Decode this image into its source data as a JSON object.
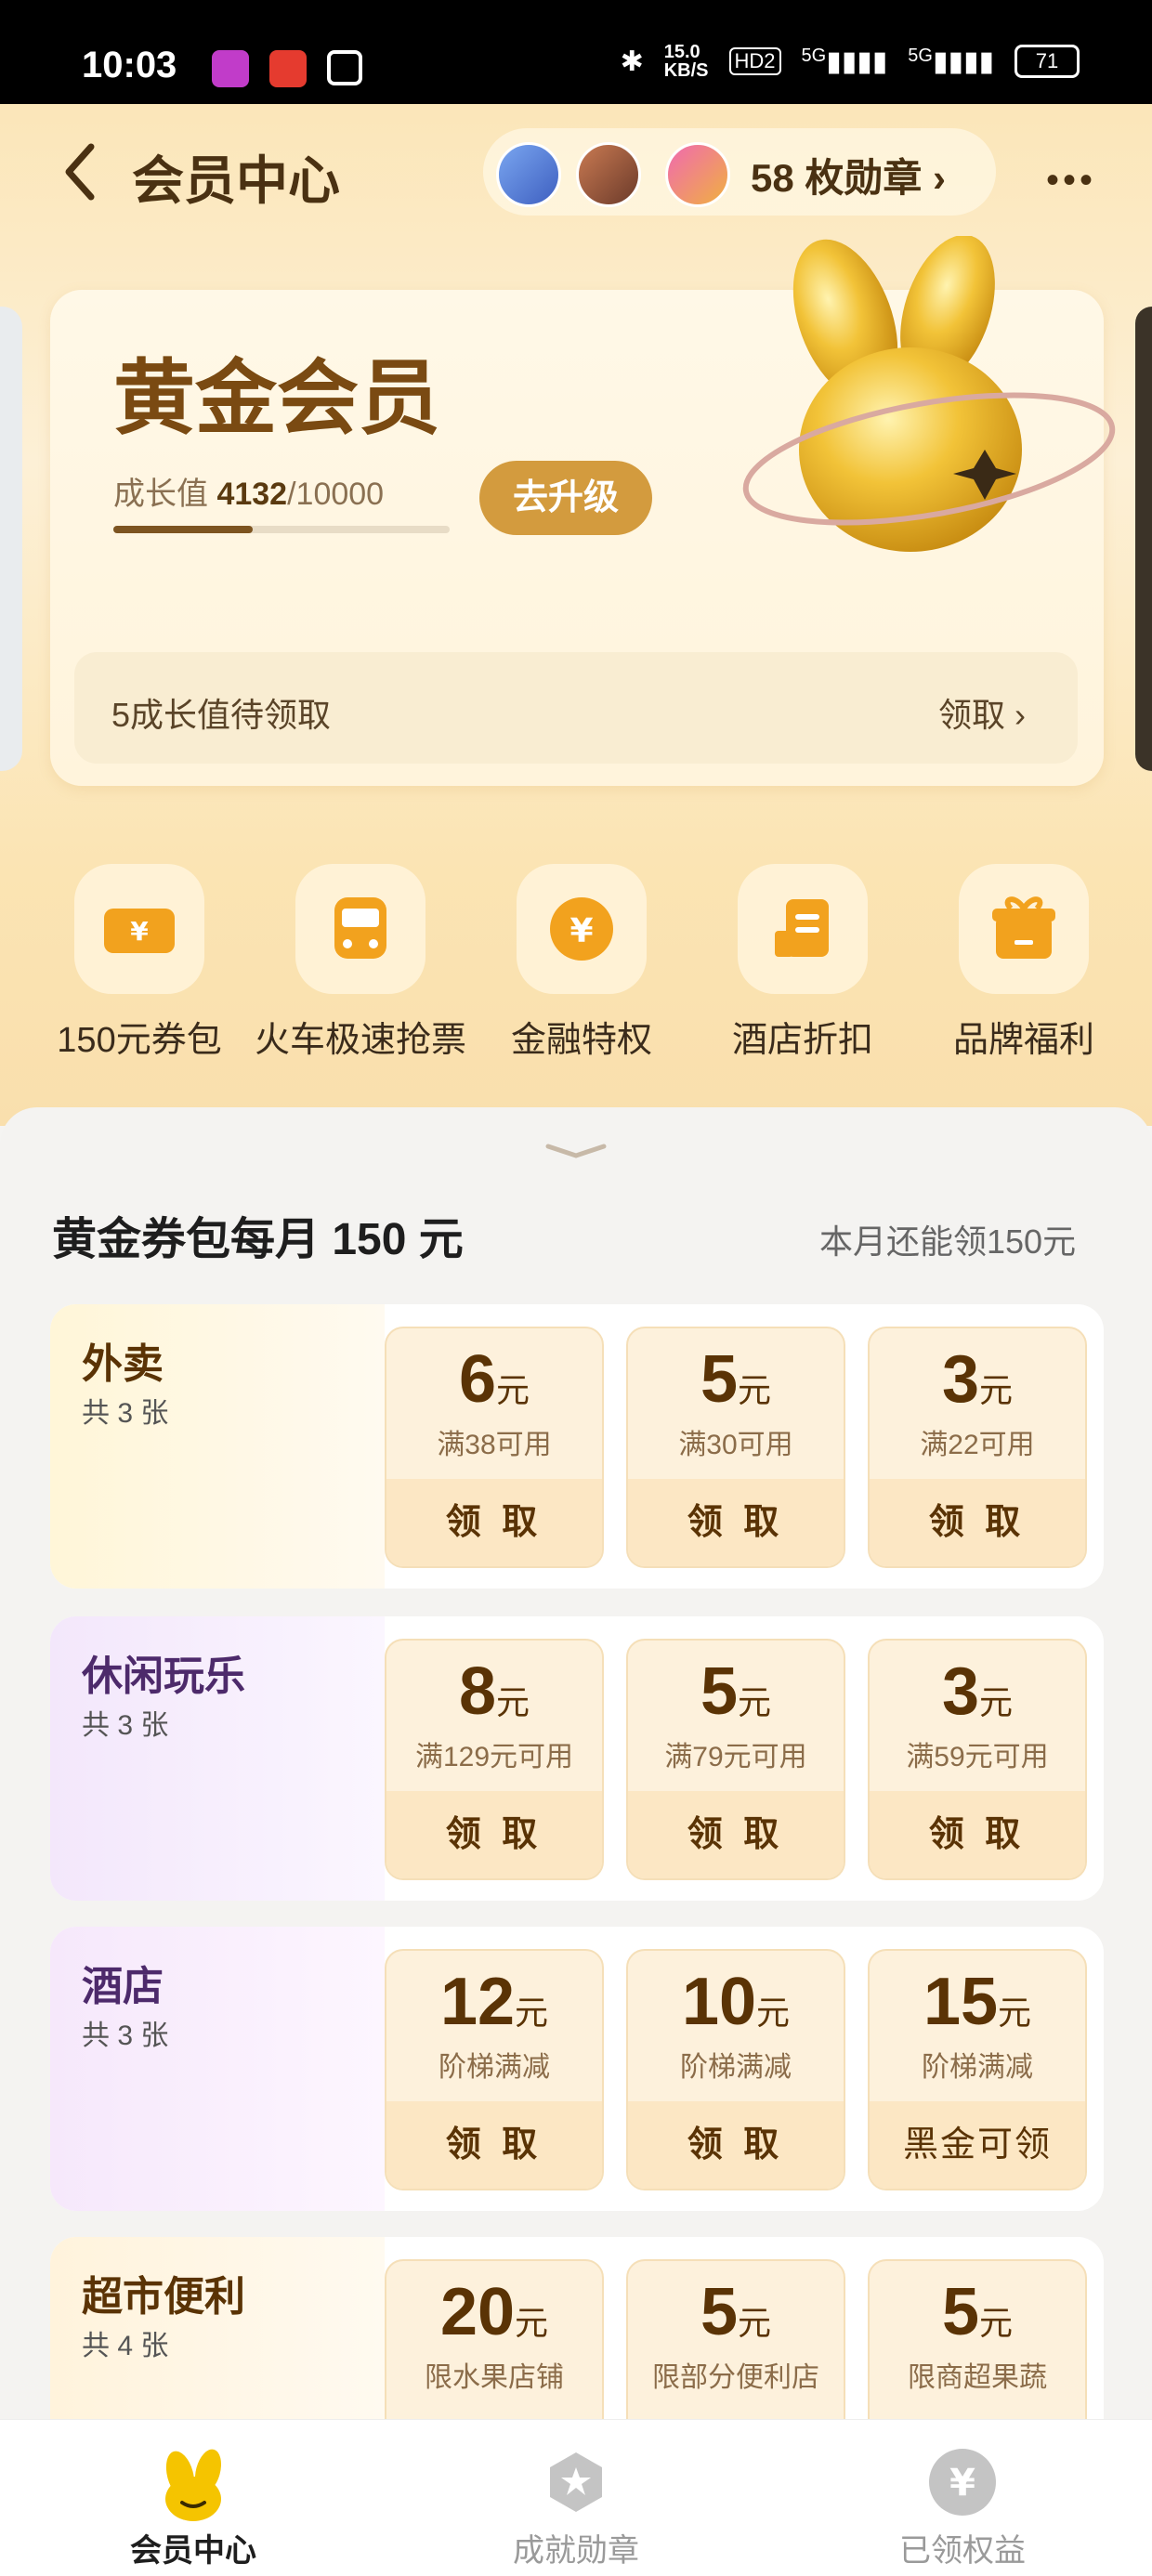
{
  "status_bar": {
    "time": "10:03",
    "net_speed": "15.0\nKB/S",
    "hd": "HD2",
    "signal1": "5G",
    "signal2": "5G",
    "battery": "71"
  },
  "header": {
    "title": "会员中心",
    "medals_text": "58 枚勋章 ›",
    "more": "•••"
  },
  "member_card": {
    "level": "黄金会员",
    "growth_label": "成长值",
    "growth_value": "4132",
    "growth_max": "/10000",
    "growth_fraction": 0.4132,
    "upgrade_button": "去升级",
    "pending_text": "5成长值待领取",
    "pending_claim": "领取 ›"
  },
  "shortcuts": [
    {
      "label": "150元券包",
      "icon": "ticket-yen-icon"
    },
    {
      "label": "火车极速抢票",
      "icon": "train-icon"
    },
    {
      "label": "金融特权",
      "icon": "coin-yen-icon"
    },
    {
      "label": "酒店折扣",
      "icon": "hotel-icon"
    },
    {
      "label": "品牌福利",
      "icon": "gift-icon"
    }
  ],
  "coupon_section": {
    "title": "黄金券包每月 150 元",
    "remaining": "本月还能领150元"
  },
  "coupon_rows": [
    {
      "name": "外卖",
      "count": "共 3 张",
      "name_color": "#5a3305",
      "coupons": [
        {
          "amount": "6",
          "unit": "元",
          "condition": "满38可用",
          "button": "领 取"
        },
        {
          "amount": "5",
          "unit": "元",
          "condition": "满30可用",
          "button": "领 取"
        },
        {
          "amount": "3",
          "unit": "元",
          "condition": "满22可用",
          "button": "领 取"
        }
      ]
    },
    {
      "name": "休闲玩乐",
      "count": "共 3 张",
      "name_color": "#4d2a6b",
      "coupons": [
        {
          "amount": "8",
          "unit": "元",
          "condition": "满129元可用",
          "button": "领 取"
        },
        {
          "amount": "5",
          "unit": "元",
          "condition": "满79元可用",
          "button": "领 取"
        },
        {
          "amount": "3",
          "unit": "元",
          "condition": "满59元可用",
          "button": "领 取"
        }
      ]
    },
    {
      "name": "酒店",
      "count": "共 3 张",
      "name_color": "#4d2a6b",
      "coupons": [
        {
          "amount": "12",
          "unit": "元",
          "condition": "阶梯满减",
          "button": "领 取"
        },
        {
          "amount": "10",
          "unit": "元",
          "condition": "阶梯满减",
          "button": "领 取"
        },
        {
          "amount": "15",
          "unit": "元",
          "condition": "阶梯满减",
          "button": "黑金可领"
        }
      ]
    },
    {
      "name": "超市便利",
      "count": "共 4 张",
      "name_color": "#5a3305",
      "coupons": [
        {
          "amount": "20",
          "unit": "元",
          "condition": "限水果店铺",
          "button": ""
        },
        {
          "amount": "5",
          "unit": "元",
          "condition": "限部分便利店",
          "button": ""
        },
        {
          "amount": "5",
          "unit": "元",
          "condition": "限商超果蔬",
          "button": ""
        }
      ]
    }
  ],
  "tab_bar": [
    {
      "label": "会员中心",
      "active": true
    },
    {
      "label": "成就勋章",
      "active": false
    },
    {
      "label": "已领权益",
      "active": false
    }
  ],
  "colors": {
    "brand_gold": "#d39b3e",
    "coupon_text": "#5a3305",
    "active_tab": "#1e1e1e",
    "inactive_tab": "#9a9a9a"
  }
}
